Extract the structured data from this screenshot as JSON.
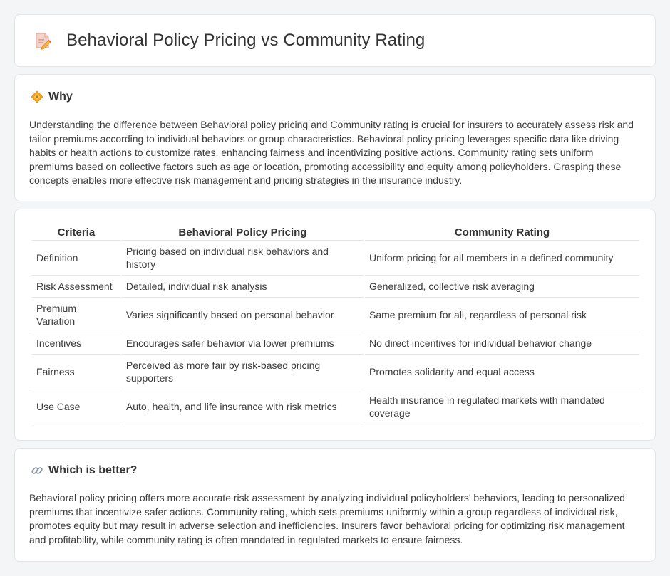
{
  "header": {
    "title": "Behavioral Policy Pricing vs Community Rating",
    "icon": "document-pencil-icon"
  },
  "why": {
    "title": "Why",
    "icon": "diamond-warning-icon",
    "body": "Understanding the difference between Behavioral policy pricing and Community rating is crucial for insurers to accurately assess risk and tailor premiums according to individual behaviors or group characteristics. Behavioral policy pricing leverages specific data like driving habits or health actions to customize rates, enhancing fairness and incentivizing positive actions. Community rating sets uniform premiums based on collective factors such as age or location, promoting accessibility and equity among policyholders. Grasping these concepts enables more effective risk management and pricing strategies in the insurance industry."
  },
  "comparison": {
    "headers": [
      "Criteria",
      "Behavioral Policy Pricing",
      "Community Rating"
    ],
    "rows": [
      [
        "Definition",
        "Pricing based on individual risk behaviors and history",
        "Uniform pricing for all members in a defined community"
      ],
      [
        "Risk Assessment",
        "Detailed, individual risk analysis",
        "Generalized, collective risk averaging"
      ],
      [
        "Premium Variation",
        "Varies significantly based on personal behavior",
        "Same premium for all, regardless of personal risk"
      ],
      [
        "Incentives",
        "Encourages safer behavior via lower premiums",
        "No direct incentives for individual behavior change"
      ],
      [
        "Fairness",
        "Perceived as more fair by risk-based pricing supporters",
        "Promotes solidarity and equal access"
      ],
      [
        "Use Case",
        "Auto, health, and life insurance with risk metrics",
        "Health insurance in regulated markets with mandated coverage"
      ]
    ]
  },
  "better": {
    "title": "Which is better?",
    "icon": "link-icon",
    "body": "Behavioral policy pricing offers more accurate risk assessment by analyzing individual policyholders' behaviors, leading to personalized premiums that incentivize safer actions. Community rating, which sets premiums uniformly within a group regardless of individual risk, promotes equity but may result in adverse selection and inefficiencies. Insurers favor behavioral pricing for optimizing risk management and profitability, while community rating is often mandated in regulated markets to ensure fairness."
  },
  "colors": {
    "background": "#f4f5f7",
    "card": "#ffffff",
    "border": "#e3e5e8",
    "text": "#333333",
    "accent_orange": "#f0a030"
  }
}
